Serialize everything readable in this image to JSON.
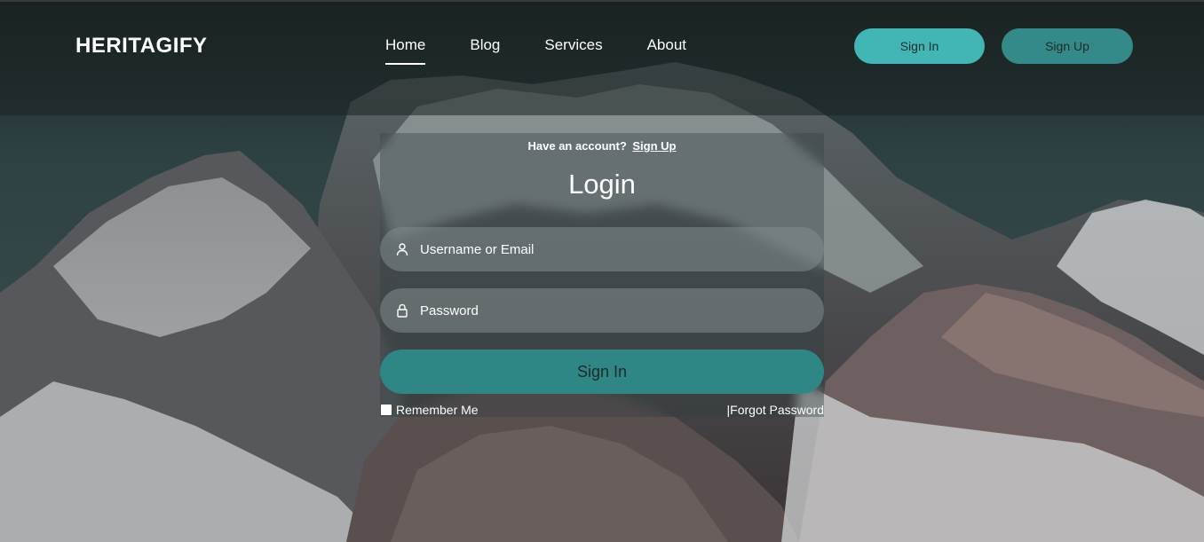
{
  "header": {
    "logo": "HERITAGIFY",
    "nav": [
      "Home",
      "Blog",
      "Services",
      "About"
    ],
    "active_nav": "Home",
    "signin_label": "Sign In",
    "signup_label": "Sign Up"
  },
  "login": {
    "have_account_text": "Have an account?",
    "have_account_link": "Sign Up",
    "title": "Login",
    "username_placeholder": "Username or Email",
    "password_placeholder": "Password",
    "submit_label": "Sign In",
    "remember_label": "Remember Me",
    "forgot_label": "|Forgot Password"
  },
  "colors": {
    "accent": "#41b6b4",
    "accent_dark": "#348a88",
    "submit": "#2f8785"
  },
  "icons": {
    "username": "user-icon",
    "password": "lock-icon"
  }
}
